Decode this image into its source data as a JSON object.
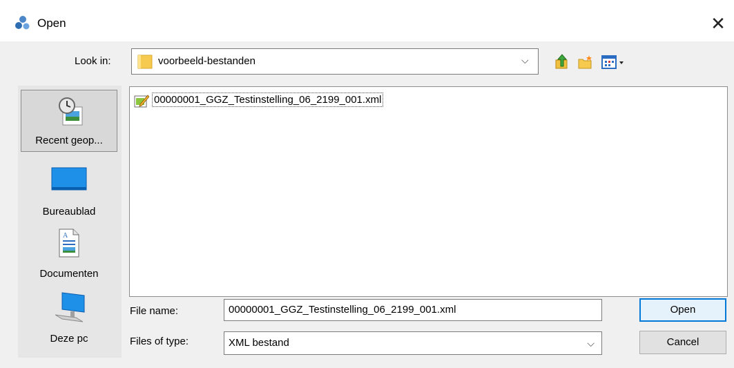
{
  "window": {
    "title": "Open",
    "close_glyph": "✕"
  },
  "look_in": {
    "label": "Look in:",
    "value": "voorbeeld-bestanden",
    "dropdown_glyph": "⌵"
  },
  "toolbar": {
    "icons": [
      "up-folder-icon",
      "new-folder-icon",
      "view-menu-icon"
    ]
  },
  "places": [
    {
      "label": "Recent geop...",
      "icon": "recent-places-icon",
      "selected": true
    },
    {
      "label": "Bureaublad",
      "icon": "desktop-icon",
      "selected": false
    },
    {
      "label": "Documenten",
      "icon": "documents-icon",
      "selected": false
    },
    {
      "label": "Deze pc",
      "icon": "this-pc-icon",
      "selected": false
    }
  ],
  "files": [
    {
      "name": "00000001_GGZ_Testinstelling_06_2199_001.xml",
      "icon": "xml-file-icon"
    }
  ],
  "file_name": {
    "label": "File name:",
    "value": "00000001_GGZ_Testinstelling_06_2199_001.xml"
  },
  "file_type": {
    "label": "Files of type:",
    "value": "XML bestand"
  },
  "buttons": {
    "open": "Open",
    "cancel": "Cancel"
  },
  "colors": {
    "accent": "#0078d7",
    "folder": "#f6c94f",
    "desktop": "#1e90e8"
  }
}
